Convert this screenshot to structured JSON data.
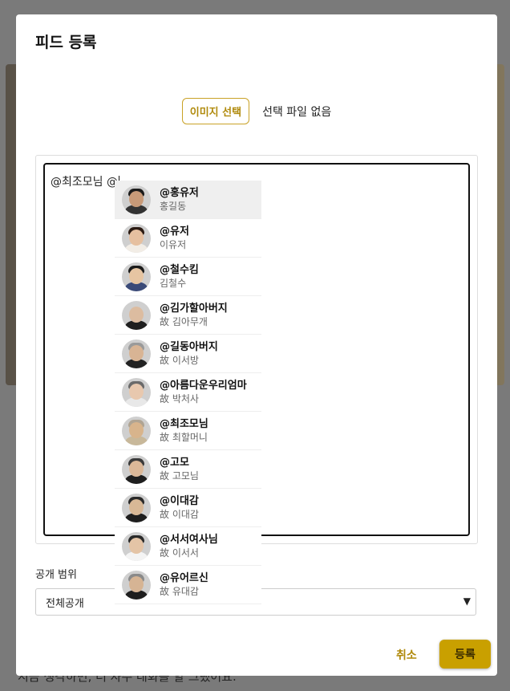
{
  "background": {
    "caption": "지금 생각하면, 더 자주 대화를 할 그랬어요."
  },
  "modal": {
    "title": "피드 등록",
    "file_button": "이미지 선택",
    "file_status": "선택 파일 없음",
    "editor_text": "@최조모님 @",
    "scope_label": "공개 범위",
    "scope_value": "전체공개",
    "cancel_label": "취소",
    "submit_label": "등록"
  },
  "mentions": [
    {
      "handle": "@홍유저",
      "name": "홍길동",
      "avatar": "avatar-young-man",
      "skin": "#c89a78",
      "hair": "#1b1b1b",
      "shirt": "#333333"
    },
    {
      "handle": "@유저",
      "name": "이유저",
      "avatar": "avatar-young-woman",
      "skin": "#e6c0a0",
      "hair": "#2a1a12",
      "shirt": "#f2ede6"
    },
    {
      "handle": "@철수킴",
      "name": "김철수",
      "avatar": "avatar-young-man",
      "skin": "#e6c5a2",
      "hair": "#1b1b1b",
      "shirt": "#3a4a78"
    },
    {
      "handle": "@김가할아버지",
      "name": "故 김아무개",
      "avatar": "avatar-elder-man",
      "skin": "#dcbca0",
      "hair": "#cfcfcf",
      "shirt": "#1f1f1f"
    },
    {
      "handle": "@길동아버지",
      "name": "故 이서방",
      "avatar": "avatar-elder-man",
      "skin": "#d8b494",
      "hair": "#9a9a9a",
      "shirt": "#222222"
    },
    {
      "handle": "@아름다운우리엄마",
      "name": "故 박처사",
      "avatar": "avatar-elder-woman",
      "skin": "#e8c8ae",
      "hair": "#6a6a6a",
      "shirt": "#e8e8e8"
    },
    {
      "handle": "@최조모님",
      "name": "故 최할머니",
      "avatar": "avatar-elder-woman",
      "skin": "#d8b48c",
      "hair": "#b0a493",
      "shirt": "#c8b89a"
    },
    {
      "handle": "@고모",
      "name": "故 고모님",
      "avatar": "avatar-elder-woman",
      "skin": "#dcb898",
      "hair": "#3a3a3a",
      "shirt": "#1e1e1e"
    },
    {
      "handle": "@이대감",
      "name": "故 이대감",
      "avatar": "avatar-man",
      "skin": "#d8b896",
      "hair": "#2a2a2a",
      "shirt": "#1e1e1e"
    },
    {
      "handle": "@서서여사님",
      "name": "故 이서서",
      "avatar": "avatar-woman",
      "skin": "#e4c4a6",
      "hair": "#2a2a2a",
      "shirt": "#f4f4f4"
    },
    {
      "handle": "@유어르신",
      "name": "故 유대감",
      "avatar": "avatar-elder-man",
      "skin": "#d6b494",
      "hair": "#8a8a8a",
      "shirt": "#1e1e1e"
    }
  ],
  "colors": {
    "accent": "#c9a000",
    "accent_text": "#b08a0c",
    "active_row": "#efefef"
  }
}
